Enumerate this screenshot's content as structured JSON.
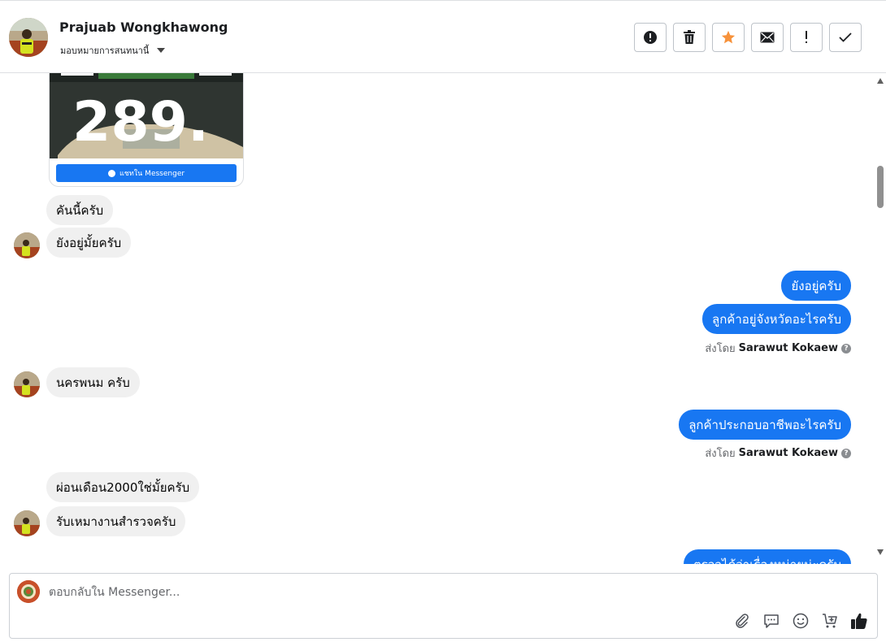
{
  "header": {
    "contact_name": "Prajuab Wongkhawong",
    "assign_label": "มอบหมายการสนทนานี้"
  },
  "actions": [
    {
      "name": "mark-spam-button",
      "icon": "alert-circle-icon"
    },
    {
      "name": "delete-button",
      "icon": "trash-icon"
    },
    {
      "name": "star-button",
      "icon": "star-icon",
      "color": "#f7923b"
    },
    {
      "name": "mark-unread-button",
      "icon": "envelope-icon"
    },
    {
      "name": "follow-up-button",
      "icon": "exclamation-icon"
    },
    {
      "name": "mark-done-button",
      "icon": "check-icon"
    }
  ],
  "card": {
    "price_text": "289.",
    "button_label": "แชทใน Messenger"
  },
  "messages": {
    "m1": "คันนี้ครับ",
    "m2": "ยังอยู่มั้ยครับ",
    "m3": "ยังอยู่ครับ",
    "m4": "ลูกค้าอยู่จังหวัดอะไรครับ",
    "m5": "นครพนม  ครับ",
    "m6": "ลูกค้าประกอบอาชีพอะไรครับ",
    "m7": "ผ่อนเดือน2000ใช่มั้ยครับ",
    "m8": "รับเหมางานสำรวจครับ",
    "m9": "ตรวจได้ว่าเรื่องหน่ายน่ะครับ"
  },
  "sent_by": {
    "prefix": "ส่งโดย",
    "agent": "Sarawut Kokaew"
  },
  "composer": {
    "placeholder": "ตอบกลับใน Messenger..."
  },
  "colors": {
    "outgoing_bubble": "#1877f2",
    "incoming_bubble": "#f0f0f0",
    "star": "#f7923b"
  }
}
